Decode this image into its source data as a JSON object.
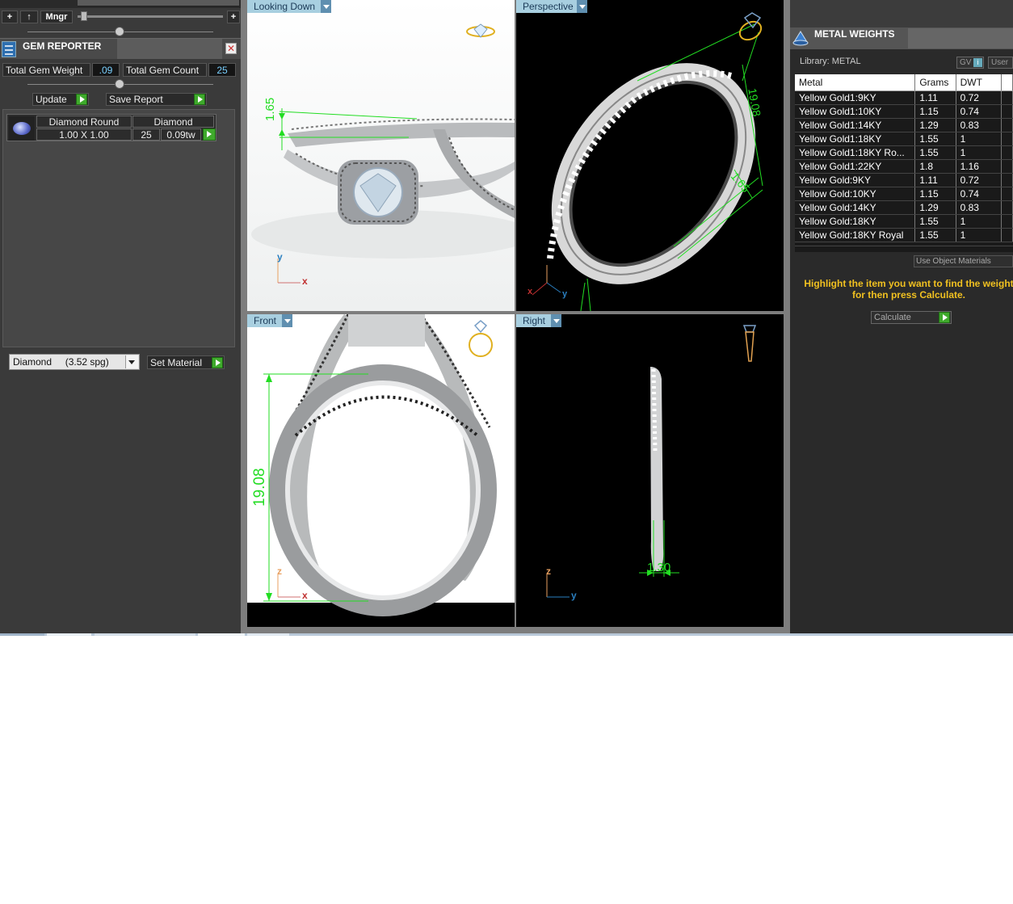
{
  "toolbar": {
    "add_label": "+",
    "up_label": "↑",
    "manager_label": "Mngr",
    "zoom_plus": "+"
  },
  "gem_reporter": {
    "title": "GEM REPORTER",
    "total_weight_label": "Total Gem Weight",
    "total_weight_value": ".09",
    "total_count_label": "Total Gem Count",
    "total_count_value": "25",
    "update_label": "Update",
    "save_report_label": "Save Report",
    "gem": {
      "shape": "Diamond Round",
      "size": "1.00 X 1.00",
      "material": "Diamond",
      "count": "25",
      "weight": "0.09tw"
    },
    "material_select": "Diamond     (3.52 spg)",
    "set_material_label": "Set Material"
  },
  "viewports": {
    "top": {
      "label": "Looking Down",
      "dim_label": "1.65",
      "axis_v": "y",
      "axis_h": "x"
    },
    "perspective": {
      "label": "Perspective",
      "dim_a": "19.08",
      "dim_b": "1.65",
      "axis_x": "x",
      "axis_y": "y"
    },
    "front": {
      "label": "Front",
      "dim_label": "19.08",
      "axis_v": "z",
      "axis_h": "x"
    },
    "right": {
      "label": "Right",
      "dim_label": "1.30",
      "axis_v": "z",
      "axis_h": "y"
    }
  },
  "metal_weights": {
    "title": "METAL WEIGHTS",
    "library_label": "Library: METAL",
    "gv_label": "GV",
    "user_label": "User",
    "columns": [
      "Metal",
      "Grams",
      "DWT"
    ],
    "rows": [
      {
        "metal": "Yellow Gold1:9KY",
        "grams": "1.11",
        "dwt": "0.72"
      },
      {
        "metal": "Yellow Gold1:10KY",
        "grams": "1.15",
        "dwt": "0.74"
      },
      {
        "metal": "Yellow Gold1:14KY",
        "grams": "1.29",
        "dwt": "0.83"
      },
      {
        "metal": "Yellow Gold1:18KY",
        "grams": "1.55",
        "dwt": "1"
      },
      {
        "metal": "Yellow Gold1:18KY Ro...",
        "grams": "1.55",
        "dwt": "1"
      },
      {
        "metal": "Yellow Gold1:22KY",
        "grams": "1.8",
        "dwt": "1.16"
      },
      {
        "metal": "Yellow Gold:9KY",
        "grams": "1.11",
        "dwt": "0.72"
      },
      {
        "metal": "Yellow Gold:10KY",
        "grams": "1.15",
        "dwt": "0.74"
      },
      {
        "metal": "Yellow Gold:14KY",
        "grams": "1.29",
        "dwt": "0.83"
      },
      {
        "metal": "Yellow Gold:18KY",
        "grams": "1.55",
        "dwt": "1"
      },
      {
        "metal": "Yellow Gold:18KY Royal",
        "grams": "1.55",
        "dwt": "1"
      }
    ],
    "use_object_materials": "Use Object Materials",
    "instructions": "Highlight the item you want to find the weight for then press Calculate.",
    "calculate_label": "Calculate"
  },
  "colors": {
    "accent_green": "#3faa2c",
    "dimension_green": "#22dd22",
    "tab_blue": "#a8cfe0",
    "instruction_yellow": "#f0c020"
  }
}
